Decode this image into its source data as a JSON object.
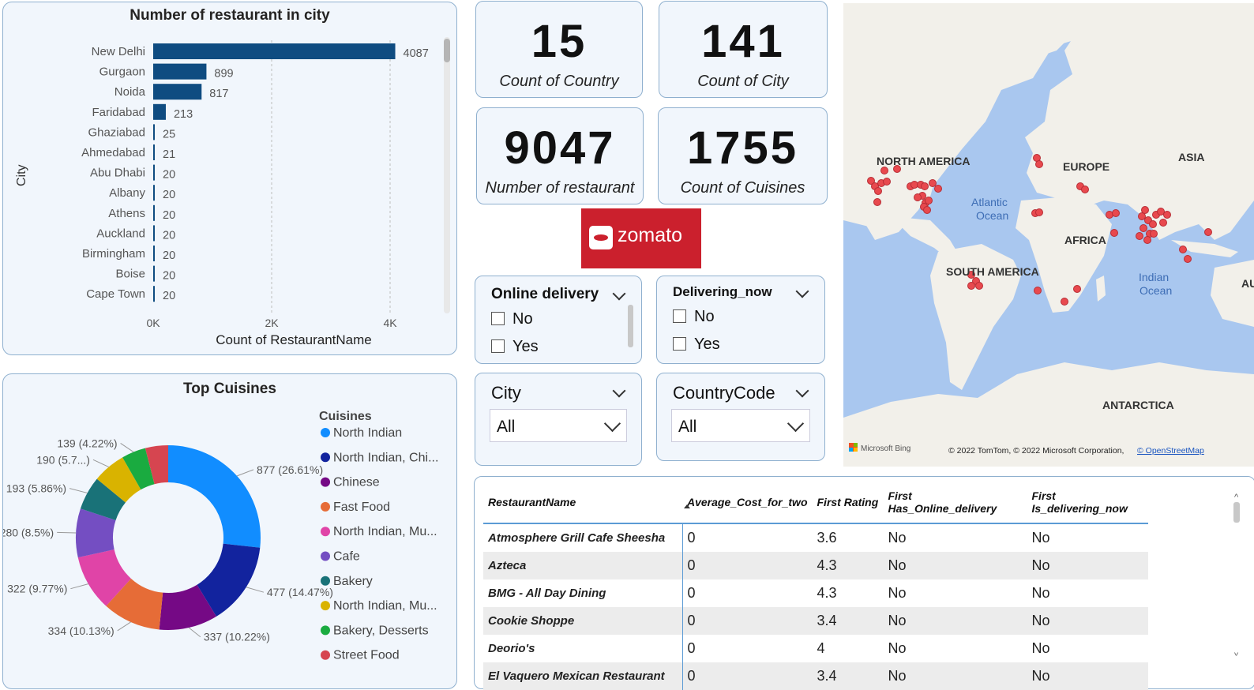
{
  "bar_chart": {
    "title": "Number of restaurant in city",
    "ylabel": "City",
    "xlabel": "Count of RestaurantName",
    "x_ticks": [
      "0K",
      "2K",
      "4K"
    ]
  },
  "kpis": [
    {
      "value": "15",
      "label": "Count of Country"
    },
    {
      "value": "141",
      "label": "Count of City"
    },
    {
      "value": "9047",
      "label": "Number of restaurant"
    },
    {
      "value": "1755",
      "label": "Count of Cuisines"
    }
  ],
  "logo": {
    "text": "zomato",
    "color": "#cb202d"
  },
  "slicers": {
    "online_delivery": {
      "title": "Online delivery",
      "options": [
        "No",
        "Yes"
      ]
    },
    "delivering_now": {
      "title": "Delivering_now",
      "options": [
        "No",
        "Yes"
      ]
    },
    "city": {
      "title": "City",
      "value": "All"
    },
    "country_code": {
      "title": "CountryCode",
      "value": "All"
    }
  },
  "map": {
    "labels": {
      "north_america": "NORTH AMERICA",
      "europe": "EUROPE",
      "asia": "ASIA",
      "atlantic_1": "Atlantic",
      "atlantic_2": "Ocean",
      "africa": "AFRICA",
      "south_america": "SOUTH AMERICA",
      "indian_1": "Indian",
      "indian_2": "Ocean",
      "au": "AU",
      "antarctica": "ANTARCTICA"
    },
    "brand": "Microsoft Bing",
    "copyright": "© 2022 TomTom, © 2022 Microsoft Corporation,",
    "osm_link": "© OpenStreetMap"
  },
  "donut": {
    "title": "Top Cuisines",
    "legend_title": "Cuisines"
  },
  "table": {
    "columns": [
      "RestaurantName",
      "Average_Cost_for_two",
      "First Rating",
      "First Has_Online_delivery",
      "First Is_delivering_now"
    ],
    "rows": [
      [
        "Atmosphere Grill Cafe Sheesha",
        "0",
        "3.6",
        "No",
        "No"
      ],
      [
        "Azteca",
        "0",
        "4.3",
        "No",
        "No"
      ],
      [
        "BMG - All Day Dining",
        "0",
        "4.3",
        "No",
        "No"
      ],
      [
        "Cookie Shoppe",
        "0",
        "3.4",
        "No",
        "No"
      ],
      [
        "Deorio's",
        "0",
        "4",
        "No",
        "No"
      ],
      [
        "El Vaquero Mexican Restaurant",
        "0",
        "3.4",
        "No",
        "No"
      ]
    ]
  },
  "chart_data": [
    {
      "type": "bar",
      "title": "Number of restaurant in city",
      "ylabel": "City",
      "xlabel": "Count of RestaurantName",
      "categories": [
        "New Delhi",
        "Gurgaon",
        "Noida",
        "Faridabad",
        "Ghaziabad",
        "Ahmedabad",
        "Abu Dhabi",
        "Albany",
        "Athens",
        "Auckland",
        "Birmingham",
        "Boise",
        "Cape Town"
      ],
      "values": [
        4087,
        899,
        817,
        213,
        25,
        21,
        20,
        20,
        20,
        20,
        20,
        20,
        20
      ],
      "xlim": [
        0,
        4000
      ],
      "x_ticks": [
        "0K",
        "2K",
        "4K"
      ],
      "color": "#0f4c81"
    },
    {
      "type": "pie",
      "title": "Top Cuisines",
      "legend_title": "Cuisines",
      "categories": [
        "North Indian",
        "North Indian, Chi...",
        "Chinese",
        "Fast Food",
        "North Indian, Mu...",
        "Cafe",
        "Bakery",
        "North Indian, Mu...",
        "Bakery, Desserts",
        "Street Food"
      ],
      "values": [
        877,
        477,
        337,
        334,
        322,
        280,
        193,
        190,
        139,
        null
      ],
      "labels": [
        "877 (26.61%)",
        "477 (14.47%)",
        "337 (10.22%)",
        "334 (10.13%)",
        "322 (9.77%)",
        "280 (8.5%)",
        "193 (5.86%)",
        "190 (5.7...)",
        "139 (4.22%)",
        ""
      ],
      "colors": [
        "#118dff",
        "#12239e",
        "#750985",
        "#e66c37",
        "#e044a7",
        "#744ec2",
        "#197278",
        "#d9b300",
        "#1aab40",
        "#d64550"
      ]
    }
  ]
}
